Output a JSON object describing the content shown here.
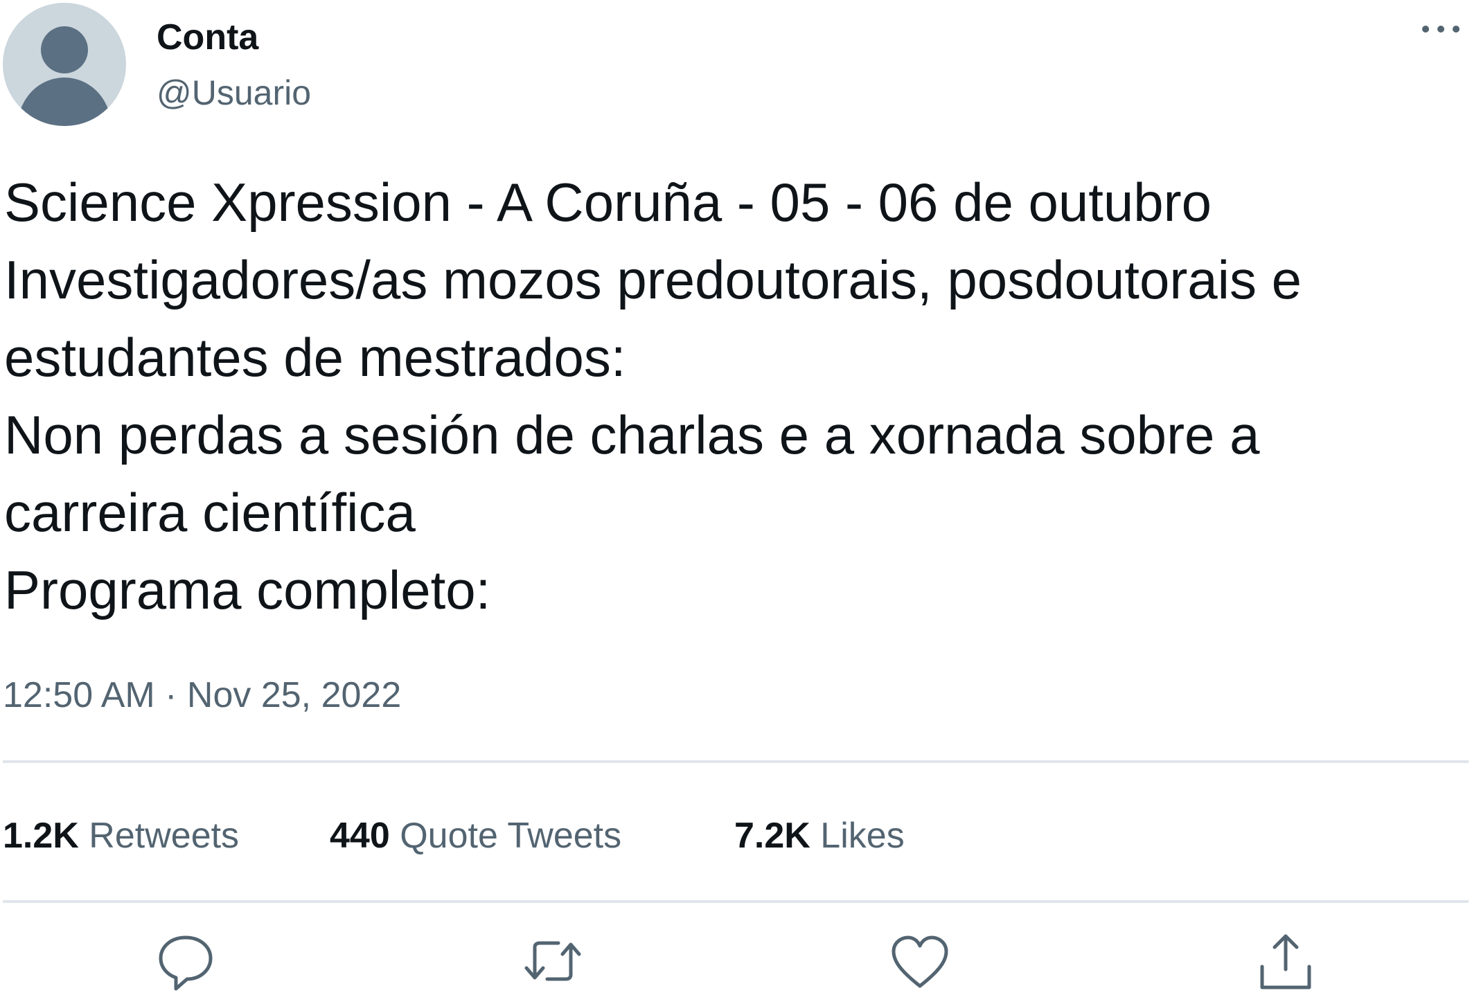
{
  "author": {
    "display_name": "Conta",
    "handle": "@Usuario"
  },
  "tweet": {
    "lines": [
      "Science Xpression - A Coruña - 05 - 06 de outubro",
      "Investigadores/as mozos predoutorais, posdoutorais e",
      "estudantes de mestrados:",
      "Non perdas a sesión de charlas e a xornada sobre a",
      "carreira científica",
      "Programa completo:"
    ],
    "timestamp": "12:50 AM · Nov 25, 2022"
  },
  "stats": {
    "retweets": {
      "count": "1.2K",
      "label": "Retweets"
    },
    "quote_tweets": {
      "count": "440",
      "label": "Quote Tweets"
    },
    "likes": {
      "count": "7.2K",
      "label": "Likes"
    }
  },
  "actions": [
    {
      "icon": "reply-icon"
    },
    {
      "icon": "retweet-icon"
    },
    {
      "icon": "like-icon"
    },
    {
      "icon": "share-icon"
    }
  ],
  "colors": {
    "text_primary": "#0f1419",
    "text_secondary": "#536471",
    "divider": "#dfe5ea",
    "avatar_bg": "#ccd6dd",
    "avatar_fg": "#5b7083"
  }
}
